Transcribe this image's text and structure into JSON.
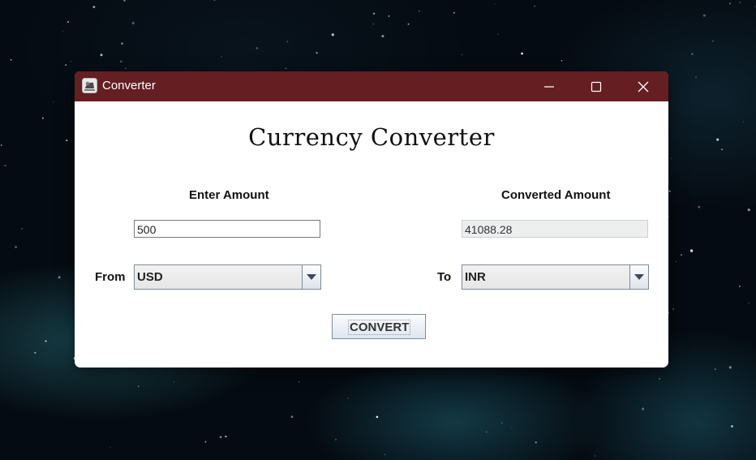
{
  "window": {
    "title": "Converter",
    "icon": "java-app-icon",
    "titlebar_color": "#651e22"
  },
  "heading": "Currency Converter",
  "labels": {
    "enter_amount": "Enter Amount",
    "converted_amount": "Converted Amount",
    "from": "From",
    "to": "To"
  },
  "inputs": {
    "amount_value": "500",
    "converted_value": "41088.28"
  },
  "selects": {
    "from_currency": "USD",
    "to_currency": "INR"
  },
  "button": {
    "convert_label": "CONVERT"
  },
  "icons": {
    "minimize": "minimize-icon",
    "maximize": "maximize-icon",
    "close": "close-icon",
    "dropdown": "chevron-down-icon"
  },
  "colors": {
    "desktop": "#050b12",
    "window_bg": "#ffffff"
  }
}
